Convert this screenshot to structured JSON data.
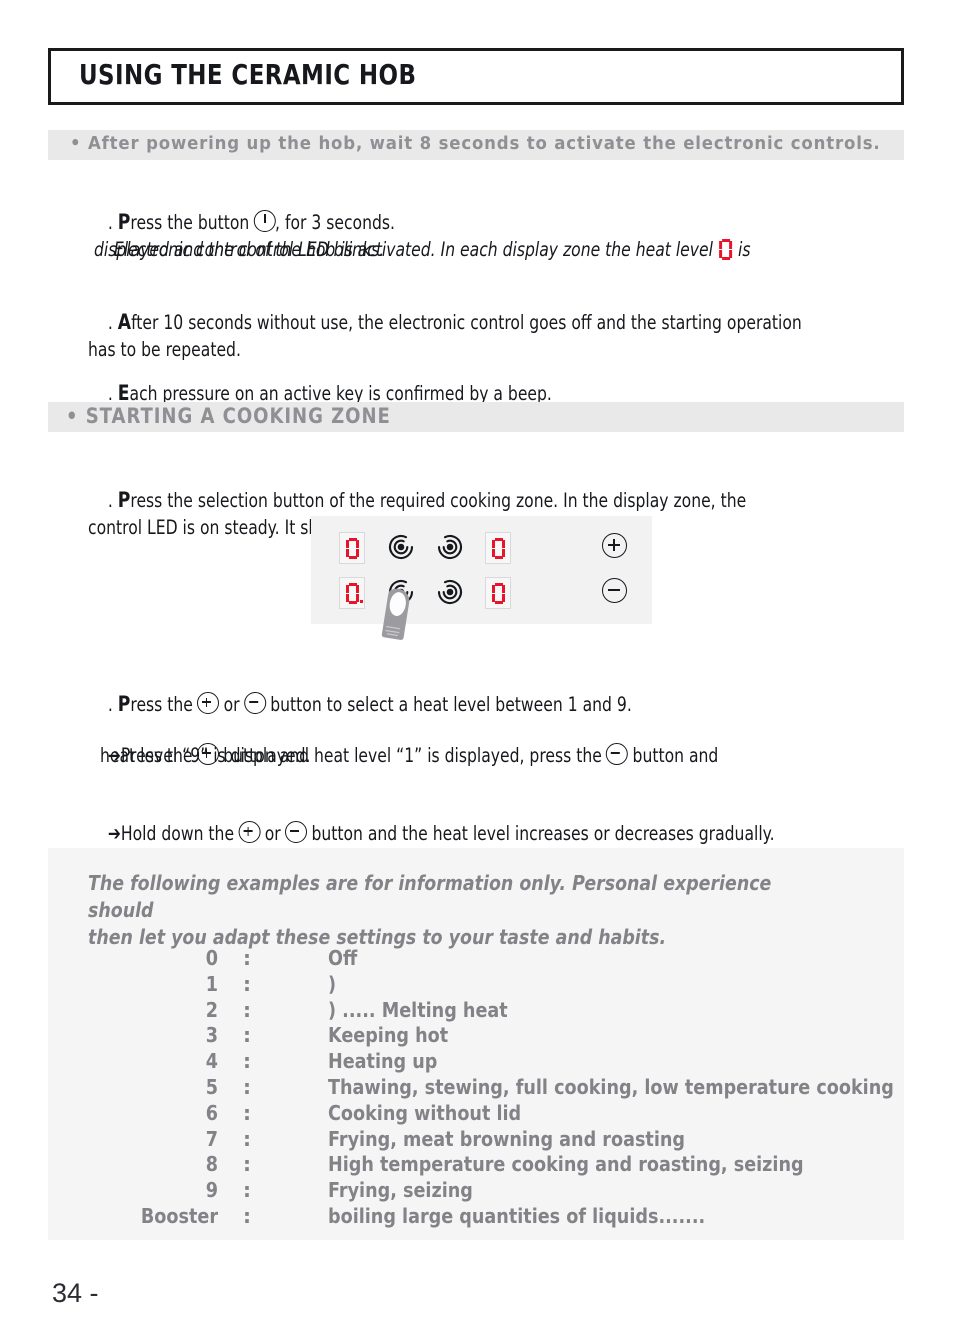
{
  "page": {
    "title": "USING THE CERAMIC HOB",
    "number": "34 -"
  },
  "notice_band": {
    "text": "• After powering up the hob, wait 8 seconds to activate the electronic controls."
  },
  "power_on": {
    "bullet_1_pre": ". ",
    "bullet_1_lead": "P",
    "bullet_1_a": "ress the button ",
    "bullet_1_b": ", for 3 seconds.",
    "italic_a": "Electronic control of the hob is activated. In each display zone the heat level ",
    "italic_b": " is",
    "italic_c": "displayed and the control LED blinks.",
    "bullet_2_lead": "A",
    "bullet_2_text": "fter 10 seconds without use, the electronic control goes off and the starting operation\nhas to be repeated.",
    "bullet_3_lead": "E",
    "bullet_3_text": "ach pressure on an active key is confirmed by a beep."
  },
  "section_band": {
    "text": "• STARTING A COOKING ZONE"
  },
  "cooking_zone": {
    "bullet_lead": "P",
    "bullet_text": "ress the selection button of the required cooking zone. In the display zone, the\ncontrol LED is on steady. It shows that the zone is live."
  },
  "hob_panel": {
    "displays": [
      {
        "value": "0",
        "decimal": false
      },
      {
        "value": "0",
        "decimal": false
      },
      {
        "value": "0",
        "decimal": true
      },
      {
        "value": "0",
        "decimal": false
      }
    ],
    "zone_icon_name": "cooking-zone-spiral",
    "plus_label": "+",
    "minus_label": "−",
    "finger_label": "pressing-finger"
  },
  "heat_select": {
    "bullet_lead": "P",
    "bullet_a": "ress the ",
    "bullet_b": " or ",
    "bullet_c": " button to select a heat level between 1 and 9.",
    "arrow_glyph": "➔",
    "arrow1_a": "Press the ",
    "arrow1_b": " button and heat level “1” is displayed, press the ",
    "arrow1_c": " button and",
    "arrow1_d": "heat level “9” is displayed.",
    "arrow2_a": "Hold down the ",
    "arrow2_b": " or ",
    "arrow2_c": " button and the heat level increases or decreases gradually."
  },
  "examples": {
    "intro": "The following examples are for information only. Personal experience should\nthen let you adapt these settings to your taste and habits.",
    "separator": ":",
    "rows": [
      {
        "level": "0",
        "desc": "Off"
      },
      {
        "level": "1",
        "desc": ")"
      },
      {
        "level": "2",
        "desc": ") ..... Melting heat"
      },
      {
        "level": "3",
        "desc": "Keeping hot"
      },
      {
        "level": "4",
        "desc": "Heating up"
      },
      {
        "level": "5",
        "desc": "Thawing, stewing, full cooking, low temperature cooking"
      },
      {
        "level": "6",
        "desc": "Cooking without lid"
      },
      {
        "level": "7",
        "desc": "Frying, meat browning and roasting"
      },
      {
        "level": "8",
        "desc": "High temperature cooking and roasting, seizing"
      },
      {
        "level": "9",
        "desc": "Frying, seizing"
      },
      {
        "level": "Booster",
        "desc": "boiling large quantities of liquids......."
      }
    ]
  },
  "colors": {
    "display_red": "#e8152a",
    "band_bg": "#e9e9ea",
    "band_text": "#909094",
    "example_bg": "#f5f5f6",
    "example_text": "#838387",
    "panel_bg": "#f2f2f3",
    "body_text": "#16181c"
  }
}
